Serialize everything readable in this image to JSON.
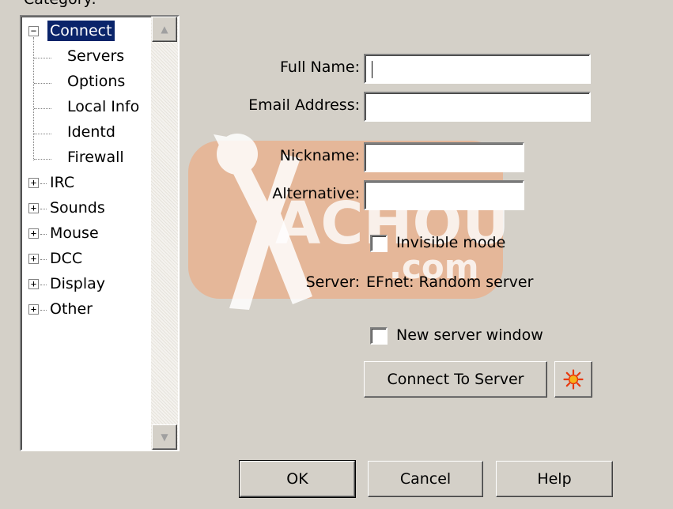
{
  "category_label": "Category:",
  "tree": {
    "items": [
      {
        "label": "Connect",
        "expander": "−",
        "selected": true
      },
      {
        "label": "Servers"
      },
      {
        "label": "Options"
      },
      {
        "label": "Local Info"
      },
      {
        "label": "Identd"
      },
      {
        "label": "Firewall"
      },
      {
        "label": "IRC",
        "expander": "+"
      },
      {
        "label": "Sounds",
        "expander": "+"
      },
      {
        "label": "Mouse",
        "expander": "+"
      },
      {
        "label": "DCC",
        "expander": "+"
      },
      {
        "label": "Display",
        "expander": "+"
      },
      {
        "label": "Other",
        "expander": "+"
      }
    ],
    "scroll_up": "▲",
    "scroll_down": "▼"
  },
  "form": {
    "full_name": {
      "label": "Full Name:",
      "value": ""
    },
    "email": {
      "label": "Email Address:",
      "value": ""
    },
    "nickname": {
      "label": "Nickname:",
      "value": ""
    },
    "alternative": {
      "label": "Alternative:",
      "value": ""
    },
    "invisible_mode": {
      "label": "Invisible mode",
      "checked": false
    },
    "server": {
      "label": "Server:",
      "value": "EFnet: Random server"
    },
    "new_server_window": {
      "label": "New server window",
      "checked": false
    },
    "connect_button": "Connect To Server"
  },
  "buttons": {
    "ok": "OK",
    "cancel": "Cancel",
    "help": "Help"
  },
  "watermark": {
    "text": "ACHOURI",
    "subtext": ".com",
    "color": "#f0a070"
  },
  "icons": {
    "options_button_icon": "sun-icon",
    "sun_color": "#e8380c"
  }
}
